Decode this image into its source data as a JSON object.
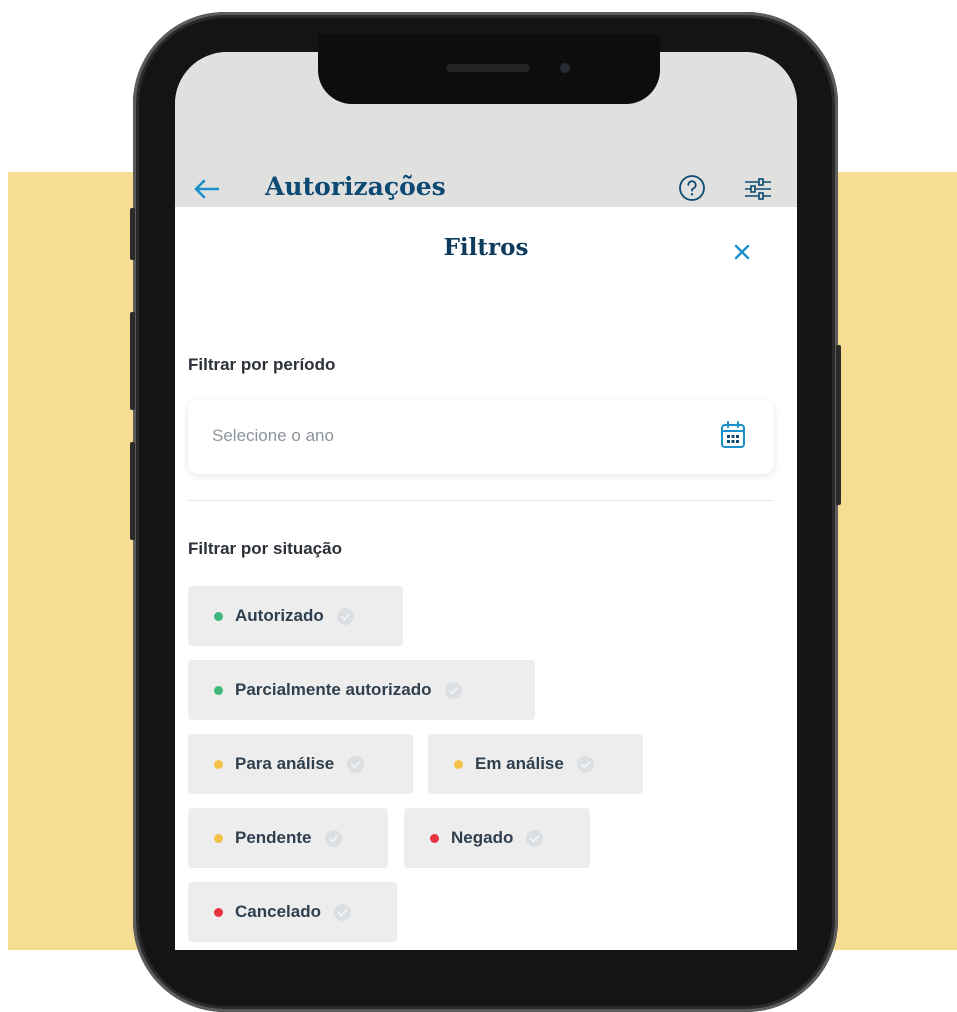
{
  "header": {
    "title": "Autorizações"
  },
  "sheet": {
    "title": "Filtros"
  },
  "period_filter": {
    "label": "Filtrar por período",
    "placeholder": "Selecione o ano"
  },
  "status_filter": {
    "label": "Filtrar por situação",
    "chips": [
      {
        "label": "Autorizado",
        "color": "#3fb77a"
      },
      {
        "label": "Parcialmente autorizado",
        "color": "#3fb77a"
      },
      {
        "label": "Para análise",
        "color": "#f3c147"
      },
      {
        "label": "Em análise",
        "color": "#f3c147"
      },
      {
        "label": "Pendente",
        "color": "#f3c147"
      },
      {
        "label": "Negado",
        "color": "#e8333e"
      },
      {
        "label": "Cancelado",
        "color": "#e8333e"
      }
    ]
  },
  "icons": {
    "back": "arrow-left-icon",
    "help": "question-circle-icon",
    "filters": "sliders-icon",
    "close": "close-icon",
    "calendar": "calendar-icon",
    "check": "check-circle-icon"
  },
  "colors": {
    "background_accent": "#f7dc93",
    "brand_dark": "#0c3b5e",
    "brand_blue": "#1a8fc9"
  }
}
